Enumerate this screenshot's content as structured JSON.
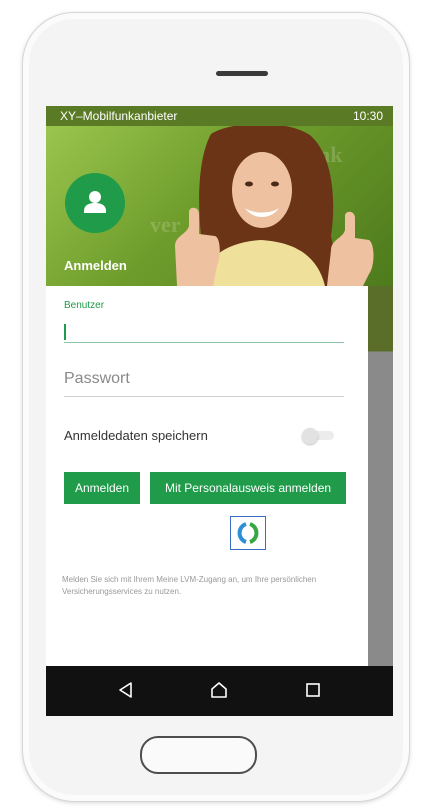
{
  "status_bar": {
    "carrier": "XY–Mobilfunkanbieter",
    "time": "10:30"
  },
  "hero": {
    "title": "Anmelden",
    "background_words": [
      "denk",
      "ver"
    ]
  },
  "form": {
    "username_label": "Benutzer",
    "username_value": "",
    "password_placeholder": "Passwort",
    "remember_label": "Anmeldedaten speichern",
    "remember_enabled": false
  },
  "buttons": {
    "login": "Anmelden",
    "id_login": "Mit Personalausweis anmelden"
  },
  "info_text": "Melden Sie sich mit Ihrem Meine LVM-Zugang an, um Ihre persönlichen Versicherungsservices zu nutzen.",
  "colors": {
    "brand_green": "#1f9b4a",
    "hero_green": "#7aa536",
    "nav_bar": "#111111"
  },
  "icons": {
    "avatar": "user-icon",
    "id_app": "ausweisapp-icon",
    "nav": [
      "back-icon",
      "home-icon",
      "recents-icon"
    ]
  }
}
